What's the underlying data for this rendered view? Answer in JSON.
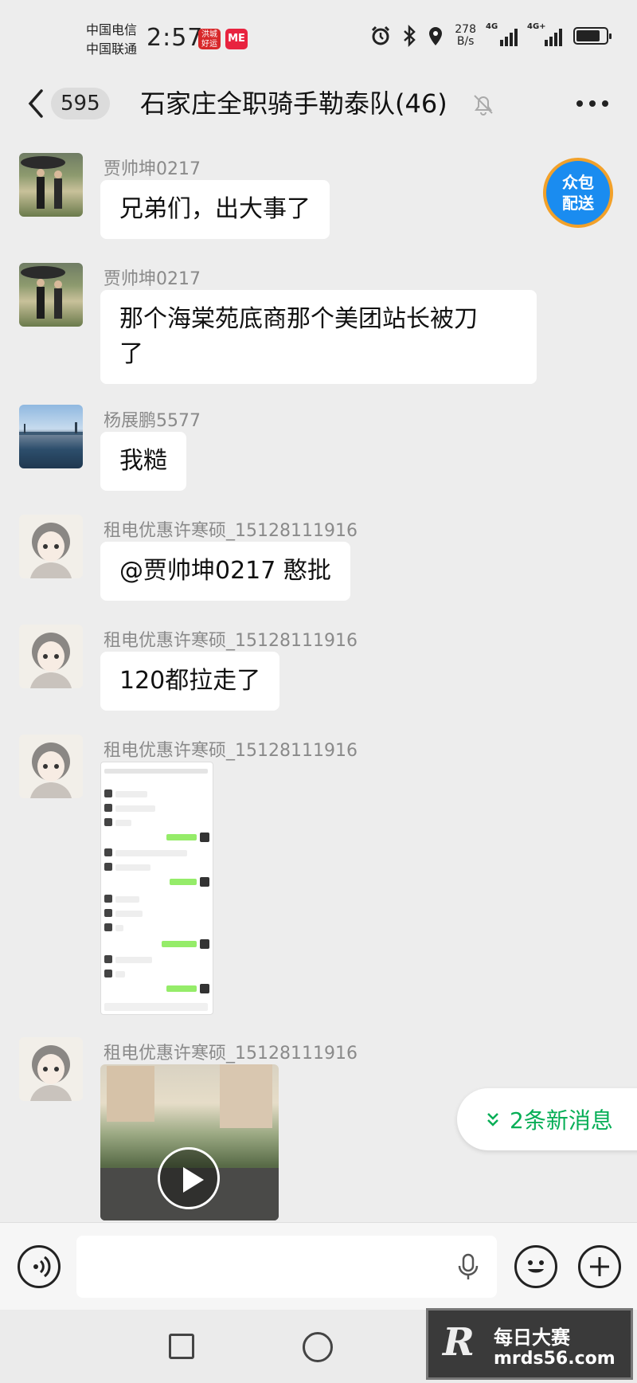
{
  "status_bar": {
    "carrier_1": "中国电信",
    "carrier_2": "中国联通",
    "time": "2:57",
    "app_badge_1": "洪城好运",
    "app_badge_2": "ME",
    "net_speed_value": "278",
    "net_speed_unit": "B/s",
    "signal_1_label": "4G",
    "signal_2_label": "4G+",
    "icons": [
      "alarm-icon",
      "bluetooth-icon",
      "location-icon",
      "battery-icon"
    ]
  },
  "header": {
    "back_icon": "chevron-left-icon",
    "unread_count": "595",
    "title": "石家庄全职骑手勒泰队(46)",
    "mute_icon": "bell-muted-icon",
    "more_icon": "more-horizontal-icon"
  },
  "messages": [
    {
      "sender": "贾帅坤0217",
      "type": "text",
      "text": "兄弟们，出大事了"
    },
    {
      "sender": "贾帅坤0217",
      "type": "text",
      "text_line1": "那个海棠苑底商那个美团站长被刀",
      "text_line2": "了"
    },
    {
      "sender": "杨展鹏5577",
      "type": "text",
      "text": "我糙"
    },
    {
      "sender": "租电优惠许寒硕_15128111916",
      "type": "text",
      "text": "@贾帅坤0217  憨批"
    },
    {
      "sender": "租电优惠许寒硕_15128111916",
      "type": "text",
      "text": "120都拉走了"
    },
    {
      "sender": "租电优惠许寒硕_15128111916",
      "type": "image"
    },
    {
      "sender": "租电优惠许寒硕_15128111916",
      "type": "video"
    }
  ],
  "floating": {
    "delivery_line1": "众包",
    "delivery_line2": "配送",
    "new_messages": "2条新消息"
  },
  "input_bar": {
    "placeholder": "",
    "icons": [
      "voice-icon",
      "microphone-icon",
      "emoji-icon",
      "plus-icon"
    ]
  },
  "watermark": {
    "logo": "R",
    "line1": "每日大赛",
    "line2": "mrds56.com"
  },
  "colors": {
    "background": "#ededed",
    "accent_green": "#06ae56",
    "delivery_blue": "#1a8cf0",
    "delivery_border": "#f2a12a"
  }
}
